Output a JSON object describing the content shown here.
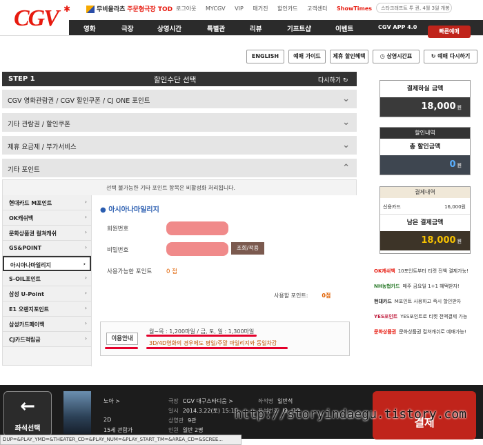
{
  "header": {
    "logo": "CGV",
    "logo_star": "✱",
    "promo_a": "무비올라츠",
    "promo_b": "주문형극장 TOD",
    "util_links": [
      "로그아웃",
      "MYCGV",
      "VIP",
      "매거진",
      "할인카드",
      "고객센터"
    ],
    "showtimes": "ShowTimes",
    "search_text": "스타크래프트 투 퀸, 4월 3일 개봉",
    "nav": [
      "영화",
      "극장",
      "상영시간",
      "특별관",
      "리뷰",
      "기프트샵",
      "이벤트",
      "CGV APP 4.0"
    ],
    "fast_booking": "빠른예매"
  },
  "toolbar": {
    "english": "ENGLISH",
    "guide": "예매 가이드",
    "discount": "제휴 할인혜택",
    "schedule": "상영시간표",
    "restart": "예매 다시하기"
  },
  "step": {
    "label": "STEP 1",
    "title": "할인수단 선택",
    "redo": "다시하기"
  },
  "accordion": [
    {
      "label": "CGV 영화관람권 / CGV 할인쿠폰 / CJ ONE 포인트",
      "arrow": "⌄"
    },
    {
      "label": "기타 관람권 / 할인쿠폰",
      "arrow": "⌄"
    },
    {
      "label": "제휴 요금제 / 부가서비스",
      "arrow": "⌄"
    },
    {
      "label": "기타 포인트",
      "arrow": "⌃"
    }
  ],
  "points": {
    "notice": "선택 불가능한 기타 포인트 항목은 비활성화 처리됩니다.",
    "items": [
      "현대카드 M포인트",
      "OK캐쉬백",
      "문화상품권 컬쳐캐쉬",
      "GS&POINT",
      "아시아나마일리지",
      "S-OIL포인트",
      "삼성 U-Point",
      "E1 오렌지포인트",
      "삼성카드페이백",
      "CJ카드적립금"
    ],
    "selected_title": "● 아시아나마일리지",
    "member_label": "회원번호",
    "password_label": "비밀번호",
    "confirm_button": "조회/적용",
    "available_label": "사용가능한 포인트",
    "available_value": "0 점",
    "use_label": "사용할 포인트:",
    "use_value": "0점",
    "info_label": "이용안내",
    "info_line1": "월~목 : 1,200마일 / 금, 토, 일 : 1,300마일",
    "info_line2": "3D/4D영화의 경우에도 평일/주말 마일리지와 동일차감"
  },
  "summary": {
    "pay_label": "결제하실 금액",
    "pay_value": "18,000",
    "discount_head": "할인내역",
    "discount_label": "총 할인금액",
    "discount_value": "0",
    "detail_head": "결제내역",
    "card_label": "신용카드",
    "card_value": "16,000원",
    "remain_label": "남은 결제금액",
    "remain_value": "18,000",
    "won": "원"
  },
  "promos": [
    {
      "brand": "OK캐쉬백",
      "text": "10포인트부터 티켓 전액 결제가능!"
    },
    {
      "brand": "NH농협카드",
      "text": "매주 금요일 1+1 혜택받자!"
    },
    {
      "brand": "현대카드",
      "text": "M포인트 사용하고 즉시 할인받자"
    },
    {
      "brand": "YES포인트",
      "text": "YES포인트로 티켓 전액결제 가능"
    },
    {
      "brand": "문화상품권",
      "text": "문화상품권 컬쳐캐쉬로 예매가능!"
    }
  ],
  "footer": {
    "back_arrow": "←",
    "back_label": "좌석선택",
    "movie_title": "노아 >",
    "format": "2D",
    "rating": "15세 관람가",
    "theater_label": "극장",
    "theater_value": "CGV 대구스타디움 >",
    "date_label": "일시",
    "date_value": "2014.3.22(토) 15:15",
    "screen_label": "상영관",
    "screen_value": "9관",
    "people_label": "인원",
    "people_value": "일반 2명",
    "seat_type_label": "좌석명",
    "seat_type_value": "일반석",
    "seat_no_label": "좌석번호",
    "seat_no_value": "I9, I10",
    "pay_label": "결제"
  },
  "watermark": "http://storyindaegu.tistory.com",
  "url_bar": "DUP=&PLAY_YMD=&THEATER_CD=&PLAY_NUM=&PLAY_START_TM=&AREA_CD=&SCREE..."
}
